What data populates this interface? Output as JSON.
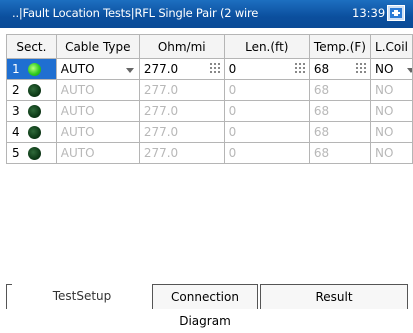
{
  "titlebar": {
    "title": "..|Fault Location Tests|RFL Single Pair (2 wire",
    "time": "13:39"
  },
  "table": {
    "headers": [
      "Sect.",
      "Cable Type",
      "Ohm/mi",
      "Len.(ft)",
      "Temp.(F)",
      "L.Coil"
    ],
    "rows": [
      {
        "sect": "1",
        "cable": "AUTO",
        "ohm": "277.0",
        "len": "0",
        "temp": "68",
        "lcoil": "NO",
        "active": true
      },
      {
        "sect": "2",
        "cable": "AUTO",
        "ohm": "277.0",
        "len": "0",
        "temp": "68",
        "lcoil": "NO",
        "active": false
      },
      {
        "sect": "3",
        "cable": "AUTO",
        "ohm": "277.0",
        "len": "0",
        "temp": "68",
        "lcoil": "NO",
        "active": false
      },
      {
        "sect": "4",
        "cable": "AUTO",
        "ohm": "277.0",
        "len": "0",
        "temp": "68",
        "lcoil": "NO",
        "active": false
      },
      {
        "sect": "5",
        "cable": "AUTO",
        "ohm": "277.0",
        "len": "0",
        "temp": "68",
        "lcoil": "NO",
        "active": false
      }
    ]
  },
  "tabs": {
    "setup": "TestSetup",
    "connection": "Connection Diagram",
    "result": "Result"
  },
  "colors": {
    "titlebar": "#0b4f9e",
    "active_section": "#1f6fd1",
    "status_active": "#2fcc1f",
    "status_inactive": "#0d3a17"
  }
}
